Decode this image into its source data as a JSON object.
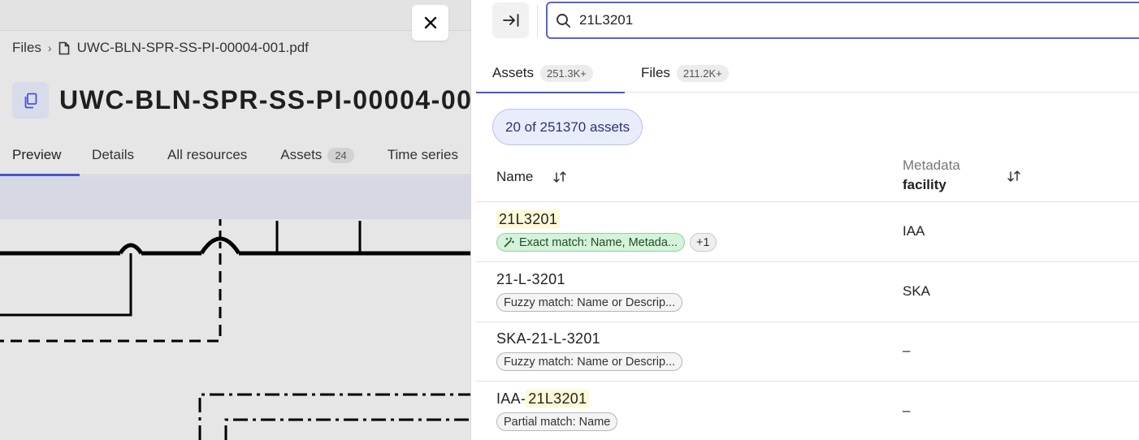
{
  "file_view": {
    "close_label": "×",
    "breadcrumb": {
      "root": "Files",
      "separator": "›",
      "file": "UWC-BLN-SPR-SS-PI-00004-001.pdf"
    },
    "title": "UWC-BLN-SPR-SS-PI-00004-001.pdf",
    "tabs": [
      {
        "label": "Preview",
        "active": true
      },
      {
        "label": "Details"
      },
      {
        "label": "All resources"
      },
      {
        "label": "Assets",
        "badge": "24"
      },
      {
        "label": "Time series"
      }
    ]
  },
  "search_panel": {
    "query": "21L3201",
    "tabs": [
      {
        "label": "Assets",
        "badge": "251.3K+",
        "active": true
      },
      {
        "label": "Files",
        "badge": "211.2K+"
      }
    ],
    "count_label": "20 of 251370 assets",
    "columns": {
      "name": "Name",
      "metadata_super": "Metadata",
      "metadata": "facility"
    },
    "rows": [
      {
        "name_pre": "",
        "name_hl": "21L3201",
        "chips": [
          "Exact match: Name, Metada...",
          "+1"
        ],
        "facility": "IAA"
      },
      {
        "name": "21-L-3201",
        "chips": [
          "Fuzzy match: Name or Descrip..."
        ],
        "facility": "SKA"
      },
      {
        "name": "SKA-21-L-3201",
        "chips": [
          "Fuzzy match: Name or Descrip..."
        ],
        "facility": "–"
      },
      {
        "name_pre": "IAA-",
        "name_hl": "21L3201",
        "chips": [
          "Partial match: Name"
        ],
        "facility": "–"
      }
    ]
  },
  "colors": {
    "accent": "#4a55c9",
    "exact_chip": "#d5f2da",
    "highlight": "#fdf9d6"
  },
  "icons": [
    "close-icon",
    "file-icon",
    "copy-icon",
    "collapse-panel-icon",
    "search-icon",
    "sort-icon",
    "magic-wand-icon"
  ]
}
